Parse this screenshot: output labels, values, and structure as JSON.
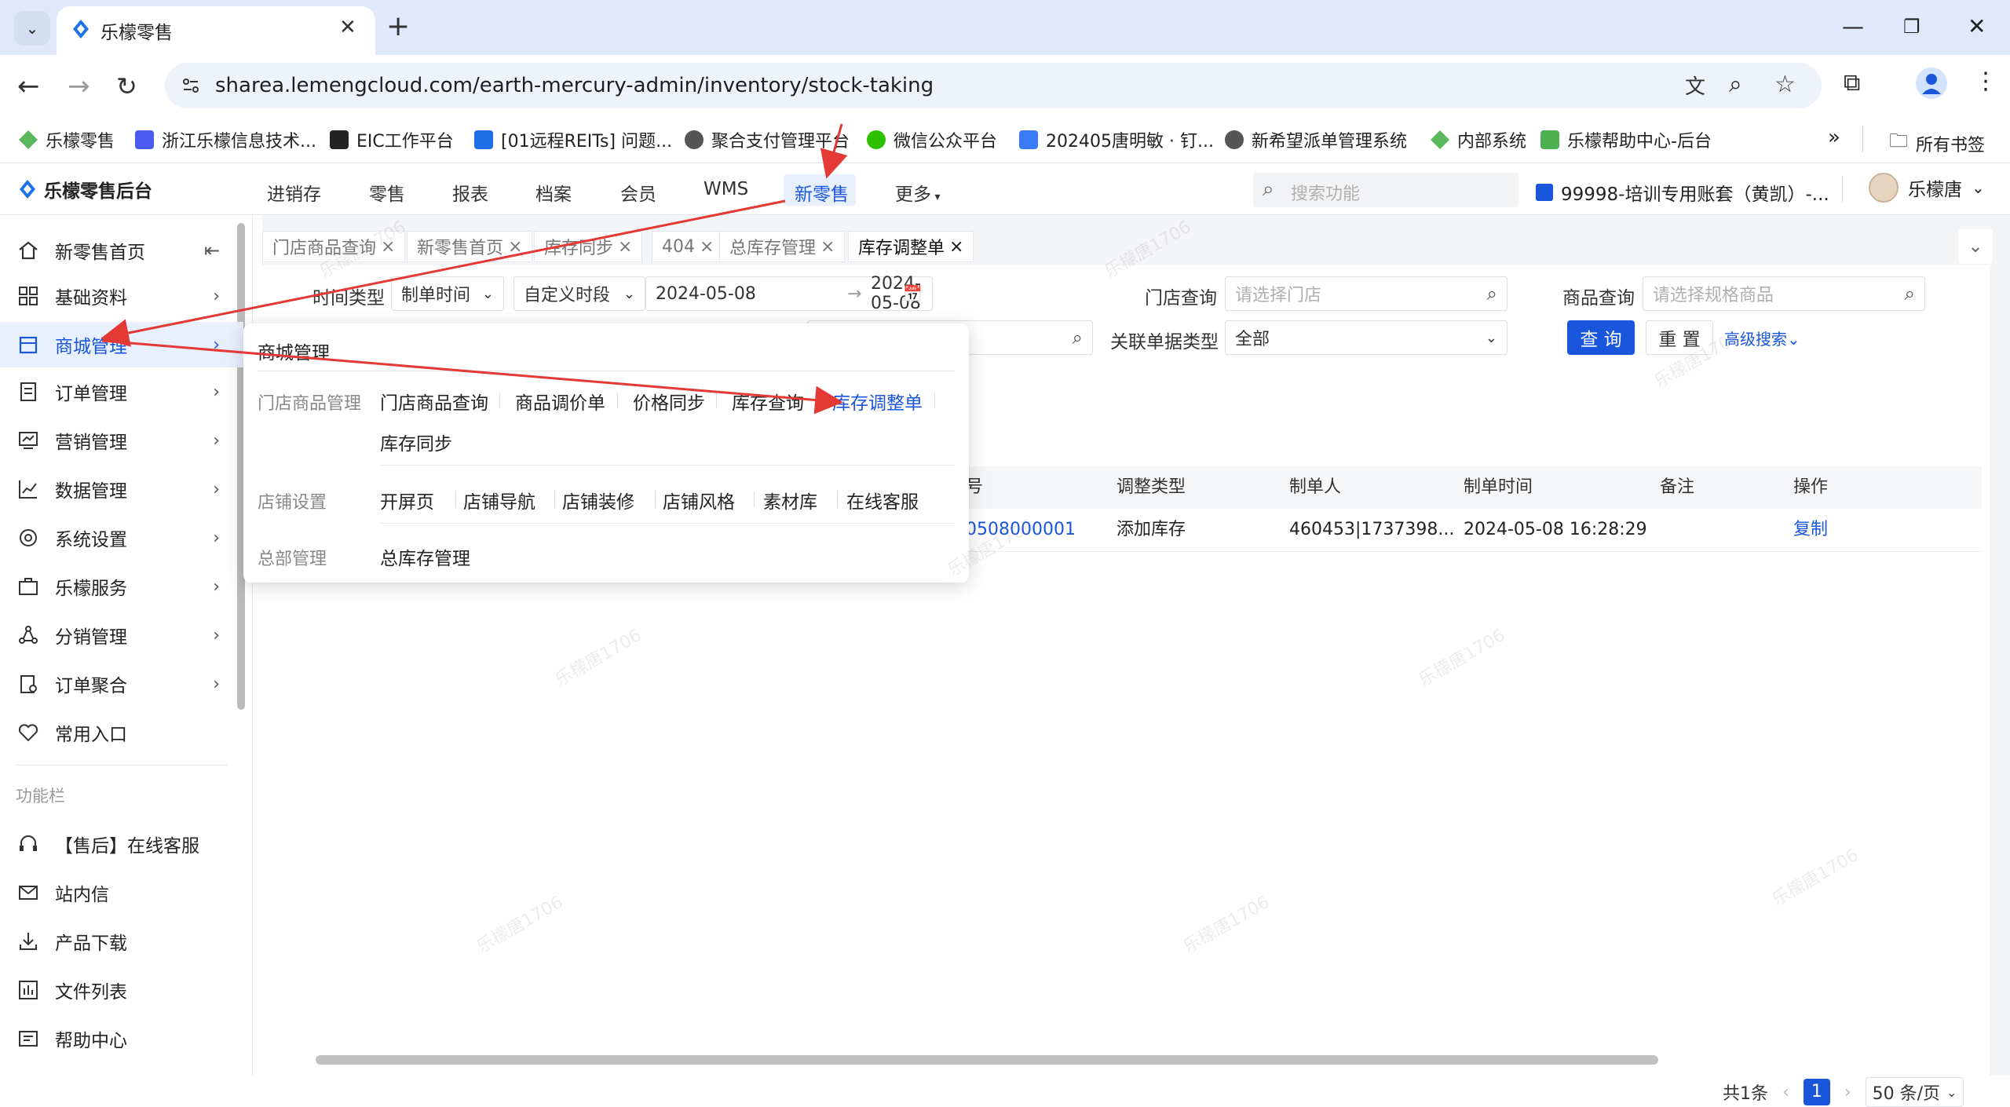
{
  "browser": {
    "tab_title": "乐檬零售",
    "url": "sharea.lemengcloud.com/earth-mercury-admin/inventory/stock-taking",
    "bookmarks": [
      "乐檬零售",
      "浙江乐檬信息技术...",
      "EIC工作平台",
      "[01远程REITs] 问题...",
      "聚合支付管理平台",
      "微信公众平台",
      "202405唐明敏 · 钉...",
      "新希望派单管理系统",
      "内部系统",
      "乐檬帮助中心-后台"
    ],
    "bookmarks_overflow": "»",
    "all_bookmarks": "所有书签"
  },
  "header": {
    "logo": "乐檬零售后台",
    "nav": [
      "进销存",
      "零售",
      "报表",
      "档案",
      "会员",
      "WMS",
      "新零售",
      "更多"
    ],
    "search_placeholder": "搜索功能",
    "account": "99998-培训专用账套（黄凯）-...",
    "user": "乐檬唐"
  },
  "sidebar": {
    "items": [
      "新零售首页",
      "基础资料",
      "商城管理",
      "订单管理",
      "营销管理",
      "数据管理",
      "系统设置",
      "乐檬服务",
      "分销管理",
      "订单聚合",
      "常用入口"
    ],
    "section_label": "功能栏",
    "tools": [
      "【售后】在线客服",
      "站内信",
      "产品下载",
      "文件列表",
      "帮助中心"
    ]
  },
  "page_tabs": [
    "门店商品查询",
    "新零售首页",
    "库存同步",
    "404",
    "总库存管理",
    "库存调整单"
  ],
  "filters": {
    "time_type_label": "时间类型",
    "time_type_value": "制单时间",
    "period_value": "自定义时段",
    "date_start": "2024-05-08",
    "date_sep": "→",
    "date_end": "2024-05-08",
    "store_label": "门店查询",
    "store_placeholder": "请选择门店",
    "goods_label": "商品查询",
    "goods_placeholder": "请选择规格商品",
    "related_label": "关联单据类型",
    "related_value": "全部",
    "query_btn": "查 询",
    "reset_btn": "重 置",
    "advanced": "高级搜索"
  },
  "table": {
    "headers": [
      "号",
      "调整类型",
      "制单人",
      "制单时间",
      "备注",
      "操作"
    ],
    "rows": [
      {
        "no": "0508000001",
        "type": "添加库存",
        "creator": "460453|1737398...",
        "time": "2024-05-08 16:28:29",
        "remark": "",
        "action": "复制"
      }
    ]
  },
  "pagination": {
    "total": "共1条",
    "page": "1",
    "page_size": "50 条/页"
  },
  "flyout": {
    "title": "商城管理",
    "groups": [
      {
        "name": "门店商品管理",
        "links": [
          "门店商品查询",
          "商品调价单",
          "价格同步",
          "库存查询",
          "库存调整单",
          "库存同步"
        ]
      },
      {
        "name": "店铺设置",
        "links": [
          "开屏页",
          "店铺导航",
          "店铺装修",
          "店铺风格",
          "素材库",
          "在线客服"
        ]
      },
      {
        "name": "总部管理",
        "links": [
          "总库存管理"
        ]
      }
    ]
  },
  "watermark": "乐檬唐1706",
  "colors": {
    "primary": "#1a56db",
    "link": "#1a56db",
    "arrow": "#e53935"
  }
}
